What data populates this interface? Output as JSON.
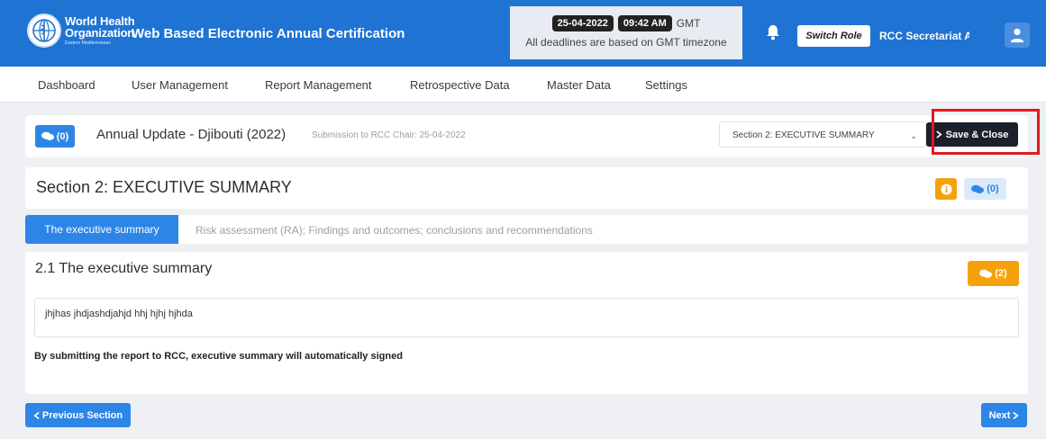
{
  "header": {
    "org_line1": "World Health",
    "org_line2": "Organization",
    "org_line3": "Eastern Mediterranean",
    "app_title": "Web Based Electronic Annual Certification",
    "date": "25-04-2022",
    "time": "09:42 AM",
    "timezone": "GMT",
    "deadline_note": "All deadlines are based on GMT timezone",
    "switch_role_label": "Switch Role",
    "user_name": "RCC Secretariat Ac",
    "icons": [
      "who-logo-icon",
      "bell-icon",
      "user-icon"
    ],
    "brand_color": "#1f73d3"
  },
  "nav": {
    "items": [
      "Dashboard",
      "User Management",
      "Report Management",
      "Retrospective Data",
      "Master Data",
      "Settings"
    ]
  },
  "report": {
    "comment_count": "(0)",
    "title": "Annual Update - Djibouti (2022)",
    "submission": "Submission to RCC Chair: 25-04-2022",
    "section_select_value": "Section 2: EXECUTIVE SUMMARY",
    "save_close_label": "Save & Close"
  },
  "section": {
    "title": "Section 2: EXECUTIVE SUMMARY",
    "comment_count": "(0)",
    "tabs": [
      "The executive summary",
      "Risk assessment (RA); Findings and outcomes; conclusions and recommendations"
    ]
  },
  "content": {
    "title": "2.1 The executive summary",
    "comment_count": "(2)",
    "text_value": "jhjhas jhdjashdjahjd hhj hjhj hjhda",
    "note": "By submitting the report to RCC, executive summary will automatically signed"
  },
  "footer": {
    "prev_label": "Previous Section",
    "next_label": "Next"
  },
  "colors": {
    "primary": "#2d86e6",
    "warning": "#f5a20a",
    "dark_button": "#1d1f2b",
    "highlight": "#e0191f"
  }
}
